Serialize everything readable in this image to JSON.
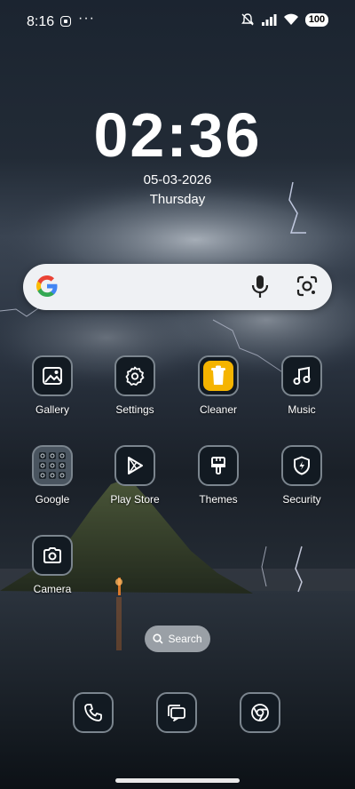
{
  "status_bar": {
    "time": "8:16",
    "overflow": "···",
    "battery": "100",
    "icons": [
      "screen-record-icon",
      "muted-bell-icon",
      "signal-icon",
      "wifi-icon",
      "battery-icon"
    ]
  },
  "clock": {
    "time": "02:36",
    "date": "05-03-2026",
    "day": "Thursday"
  },
  "search_widget": {
    "icons": [
      "google-logo-icon",
      "mic-icon",
      "lens-icon"
    ]
  },
  "apps": [
    {
      "label": "Gallery",
      "icon": "gallery-icon"
    },
    {
      "label": "Settings",
      "icon": "gear-icon"
    },
    {
      "label": "Cleaner",
      "icon": "cleaner-icon",
      "accent": "#f5b400"
    },
    {
      "label": "Music",
      "icon": "music-note-icon"
    },
    {
      "label": "Google",
      "icon": "google-folder-icon"
    },
    {
      "label": "Play Store",
      "icon": "play-store-icon"
    },
    {
      "label": "Themes",
      "icon": "paint-brush-icon"
    },
    {
      "label": "Security",
      "icon": "shield-icon"
    },
    {
      "label": "Camera",
      "icon": "camera-icon"
    }
  ],
  "search_pill": {
    "label": "Search"
  },
  "dock": [
    {
      "icon": "phone-icon"
    },
    {
      "icon": "messages-icon"
    },
    {
      "icon": "chrome-icon"
    }
  ]
}
